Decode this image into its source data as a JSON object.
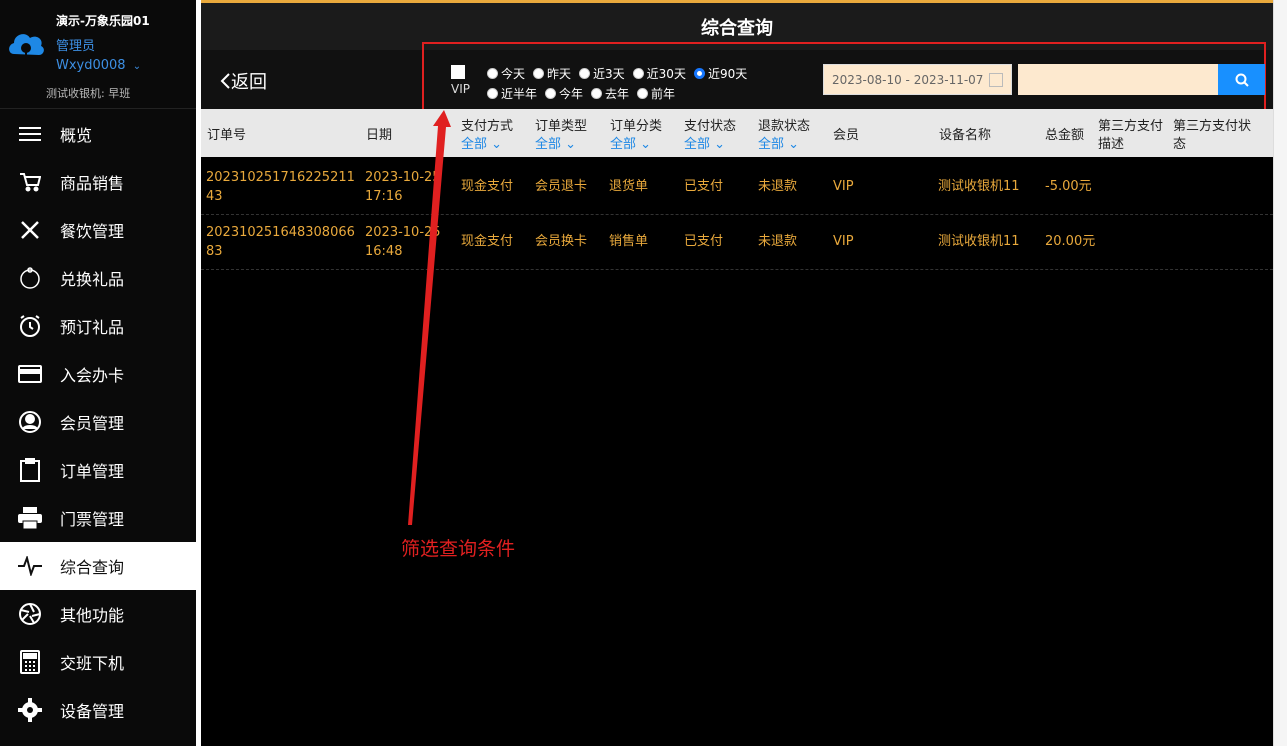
{
  "sidebar": {
    "store_name": "演示-万象乐园01",
    "role": "管理员",
    "account": "Wxyd0008",
    "terminal": "测试收银机: 早班",
    "items": [
      {
        "label": "概览",
        "icon": "menu-icon"
      },
      {
        "label": "商品销售",
        "icon": "cart-icon"
      },
      {
        "label": "餐饮管理",
        "icon": "utensils-icon"
      },
      {
        "label": "兑换礼品",
        "icon": "gift-icon"
      },
      {
        "label": "预订礼品",
        "icon": "alarm-icon"
      },
      {
        "label": "入会办卡",
        "icon": "card-icon"
      },
      {
        "label": "会员管理",
        "icon": "user-icon"
      },
      {
        "label": "订单管理",
        "icon": "clipboard-icon"
      },
      {
        "label": "门票管理",
        "icon": "printer-icon"
      },
      {
        "label": "综合查询",
        "icon": "pulse-icon"
      },
      {
        "label": "其他功能",
        "icon": "aperture-icon"
      },
      {
        "label": "交班下机",
        "icon": "calculator-icon"
      },
      {
        "label": "设备管理",
        "icon": "gear-icon"
      }
    ],
    "active_index": 9
  },
  "header": {
    "title": "综合查询"
  },
  "toolbar": {
    "back_label": "返回",
    "vip_label": "VIP",
    "quick_ranges_row1": [
      "今天",
      "昨天",
      "近3天",
      "近30天",
      "近90天"
    ],
    "quick_ranges_row2": [
      "近半年",
      "今年",
      "去年",
      "前年"
    ],
    "selected_range": "近90天",
    "date_range": "2023-08-10 - 2023-11-07",
    "search_value": ""
  },
  "table": {
    "columns": {
      "order_no": "订单号",
      "date": "日期",
      "payment": "支付方式",
      "order_type": "订单类型",
      "order_category": "订单分类",
      "pay_status": "支付状态",
      "refund_status": "退款状态",
      "member": "会员",
      "device": "设备名称",
      "total": "总金额",
      "third_desc": "第三方支付描述",
      "third_status": "第三方支付状态"
    },
    "filter_all": "全部",
    "rows": [
      {
        "order_no": "20231025171622521143",
        "date": "2023-10-25 17:16",
        "payment": "现金支付",
        "order_type": "会员退卡",
        "order_category": "退货单",
        "pay_status": "已支付",
        "refund_status": "未退款",
        "member": "VIP",
        "device": "测试收银机11",
        "total": "-5.00元"
      },
      {
        "order_no": "20231025164830806683",
        "date": "2023-10-25 16:48",
        "payment": "现金支付",
        "order_type": "会员换卡",
        "order_category": "销售单",
        "pay_status": "已支付",
        "refund_status": "未退款",
        "member": "VIP",
        "device": "测试收银机11",
        "total": "20.00元"
      }
    ]
  },
  "annotation": {
    "label": "筛选查询条件"
  },
  "colors": {
    "accent": "#e9a93c",
    "link": "#1e88e5",
    "annotation": "#e02020",
    "search_button": "#1890ff"
  }
}
